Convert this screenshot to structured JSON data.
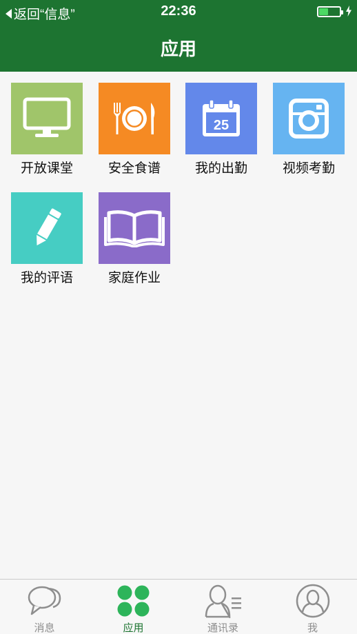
{
  "status_bar": {
    "back_label": "返回“信息”",
    "time": "22:36",
    "battery_level": 0.35
  },
  "nav": {
    "title": "应用"
  },
  "apps": [
    {
      "label": "开放课堂",
      "icon": "monitor-icon",
      "color": "#a0c56a"
    },
    {
      "label": "安全食谱",
      "icon": "dinner-plate-icon",
      "color": "#f58a23"
    },
    {
      "label": "我的出勤",
      "icon": "calendar-icon",
      "color": "#6388ea",
      "calendar_day": "25"
    },
    {
      "label": "视频考勤",
      "icon": "camera-icon",
      "color": "#66b4f1"
    },
    {
      "label": "我的评语",
      "icon": "pencil-icon",
      "color": "#46cdc3"
    },
    {
      "label": "家庭作业",
      "icon": "open-book-icon",
      "color": "#8a6bc9"
    }
  ],
  "tabs": [
    {
      "label": "消息",
      "icon": "chat-bubbles-icon",
      "active": false
    },
    {
      "label": "应用",
      "icon": "apps-grid-icon",
      "active": true
    },
    {
      "label": "通讯录",
      "icon": "contacts-icon",
      "active": false
    },
    {
      "label": "我",
      "icon": "profile-icon",
      "active": false
    }
  ],
  "colors": {
    "header": "#1d7431",
    "active_tab": "#1d7431",
    "inactive_tab": "#8e8e8e",
    "background": "#f6f6f6"
  }
}
